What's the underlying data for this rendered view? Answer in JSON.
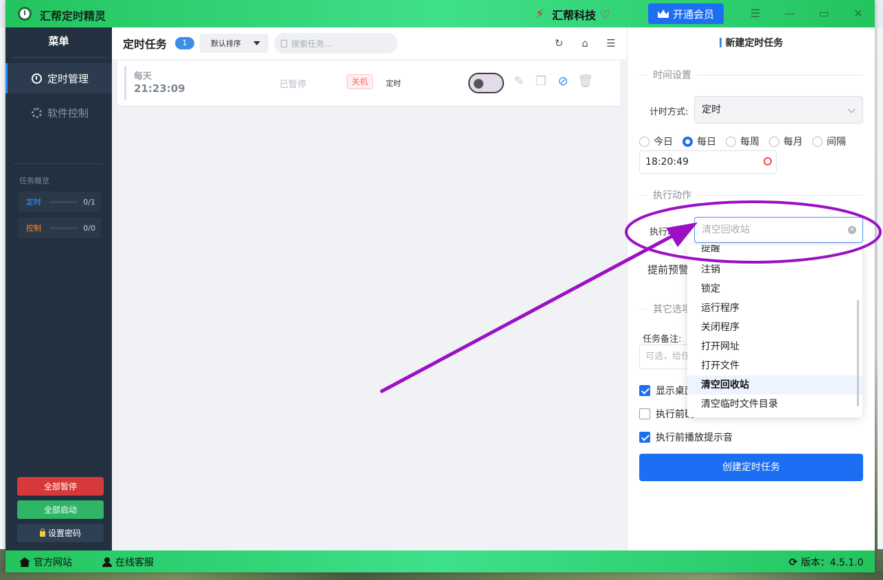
{
  "window": {
    "app_title": "汇帮定时精灵",
    "brand_name": "汇帮科技",
    "vip_label": "开通会员",
    "controls": [
      "menu-icon",
      "minimize-icon",
      "maximize-icon",
      "close-icon"
    ]
  },
  "sidebar": {
    "title": "菜单",
    "nav": [
      {
        "label": "定时管理",
        "icon": "clock-icon",
        "active": true
      },
      {
        "label": "软件控制",
        "icon": "gear-icon",
        "active": false
      }
    ],
    "overview": {
      "label": "任务概览",
      "rows": [
        {
          "label": "定时",
          "count": "0/1",
          "color": "#3f9bff"
        },
        {
          "label": "控制",
          "count": "0/0",
          "color": "#ff8a2b"
        }
      ]
    },
    "buttons": {
      "pause_all": "全部暂停",
      "start_all": "全部启动",
      "set_password": "设置密码"
    },
    "button_colors": {
      "pause": "#d6393a",
      "start": "#2fb566",
      "password": "#2e4054"
    }
  },
  "main": {
    "title": "定时任务",
    "count": "1",
    "sort_label": "默认排序",
    "search_placeholder": "搜索任务...",
    "tasks": [
      {
        "frequency": "每天",
        "time": "21:23:09",
        "status": "已暂停",
        "tag": "关机",
        "type": "定时",
        "enabled": false
      }
    ]
  },
  "panel": {
    "title": "新建定时任务",
    "time_section": "时间设置",
    "timer_mode_label": "计时方式:",
    "timer_mode_value": "定时",
    "radios": [
      {
        "label": "今日",
        "checked": false
      },
      {
        "label": "每日",
        "checked": true
      },
      {
        "label": "每周",
        "checked": false
      },
      {
        "label": "每月",
        "checked": false
      },
      {
        "label": "间隔",
        "checked": false
      }
    ],
    "time_value": "18:20:49",
    "action_section": "执行动作",
    "action_label": "执行动作:",
    "action_placeholder": "清空回收站",
    "warning_label": "提前预警:",
    "other_section": "其它选项",
    "note_label": "任务备注:",
    "note_placeholder": "可选，给任务",
    "checks": [
      {
        "label": "显示桌面",
        "checked": true
      },
      {
        "label": "执行前确",
        "checked": false
      },
      {
        "label": "执行前播放提示音",
        "checked": true
      }
    ],
    "create_button": "创建定时任务"
  },
  "dropdown": {
    "partial_item": "提醒",
    "items": [
      "注销",
      "锁定",
      "运行程序",
      "关闭程序",
      "打开网址",
      "打开文件",
      "清空回收站",
      "清空临时文件目录"
    ],
    "selected": "清空回收站"
  },
  "statusbar": {
    "website": "官方网站",
    "support": "在线客服",
    "version": "版本：4.5.1.0"
  },
  "annotation": {
    "color": "#9b10c4"
  }
}
